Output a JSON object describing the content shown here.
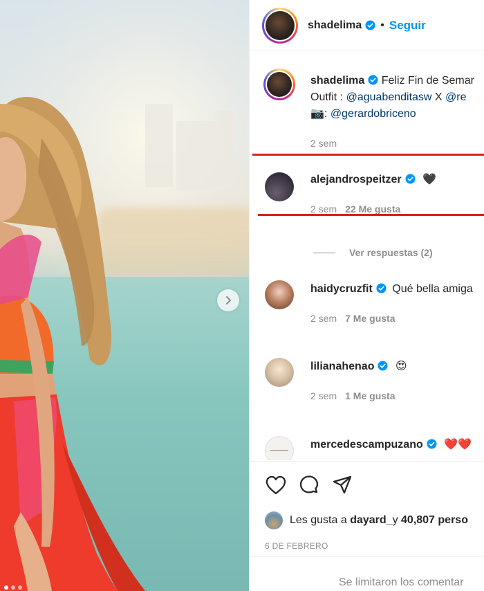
{
  "header": {
    "username": "shadelima",
    "separator": "•",
    "follow_label": "Seguir"
  },
  "caption": {
    "username": "shadelima",
    "text_line1": "Feliz Fin de Semar",
    "outfit_label": "Outfit : ",
    "outfit_link1": "@aguabenditasw",
    "outfit_x": " X ",
    "outfit_link2": "@re",
    "camera_emoji": "📷",
    "photo_sep": ": ",
    "photo_link": "@gerardobriceno",
    "time": "2 sem"
  },
  "comments": [
    {
      "username": "alejandrospeitzer",
      "text": "🖤",
      "time": "2 sem",
      "likes": "22 Me gusta"
    },
    {
      "username": "haidycruzfit",
      "text": "Qué bella amiga",
      "time": "2 sem",
      "likes": "7 Me gusta"
    },
    {
      "username": "lilianahenao",
      "text": "😍",
      "time": "2 sem",
      "likes": "1 Me gusta"
    },
    {
      "username": "mercedescampuzano",
      "text": "❤️❤️"
    }
  ],
  "replies_label": "Ver respuestas (2)",
  "likes_line": {
    "prefix": "Les gusta a ",
    "user": "dayard_",
    "middle": " y ",
    "count": "40,807 perso"
  },
  "date": "6 DE FEBRERO",
  "footer_text": "Se limitaron los comentar",
  "colors": {
    "accent": "#0095f6",
    "annotation_red": "#d61f1f",
    "muted": "#8e8e8e"
  },
  "icons": [
    "verified-badge-icon",
    "chevron-right-icon",
    "heart-icon",
    "comment-icon",
    "share-icon"
  ]
}
